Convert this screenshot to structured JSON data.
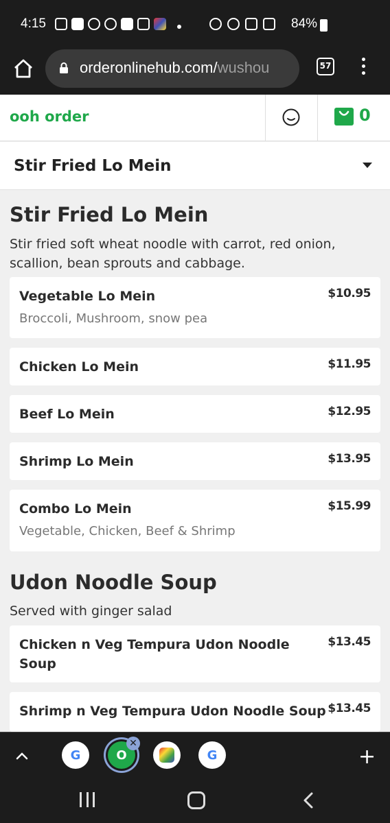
{
  "status_bar": {
    "time": "4:15",
    "battery": "84%"
  },
  "browser": {
    "url_main": "orderonlinehub.com/",
    "url_path": "wushou",
    "tab_count": "57"
  },
  "site": {
    "brand": "ooh order",
    "cart_count": "0",
    "category_selected": "Stir Fried Lo Mein"
  },
  "sections": [
    {
      "title": "Stir Fried Lo Mein",
      "description": "Stir fried soft wheat noodle with carrot, red onion, scallion, bean sprouts and cabbage.",
      "items": [
        {
          "name": "Vegetable Lo Mein",
          "price": "$10.95",
          "description": "Broccoli, Mushroom, snow pea"
        },
        {
          "name": "Chicken Lo Mein",
          "price": "$11.95"
        },
        {
          "name": "Beef Lo Mein",
          "price": "$12.95"
        },
        {
          "name": "Shrimp Lo Mein",
          "price": "$13.95"
        },
        {
          "name": "Combo Lo Mein",
          "price": "$15.99",
          "description": "Vegetable, Chicken, Beef & Shrimp"
        }
      ]
    },
    {
      "title": "Udon Noodle Soup",
      "description": "Served with ginger salad",
      "items": [
        {
          "name": "Chicken n Veg Tempura Udon Noodle Soup",
          "price": "$13.45"
        },
        {
          "name": "Shrimp n Veg Tempura Udon Noodle Soup",
          "price": "$13.45"
        }
      ]
    }
  ],
  "tab_strip": {
    "tabs": [
      "G",
      "O",
      "",
      "G"
    ],
    "close_glyph": "✕",
    "plus_glyph": "+"
  },
  "colors": {
    "brand_green": "#1fa84a",
    "dark_bg": "#1c1c1c",
    "page_bg": "#f0f0f0"
  }
}
